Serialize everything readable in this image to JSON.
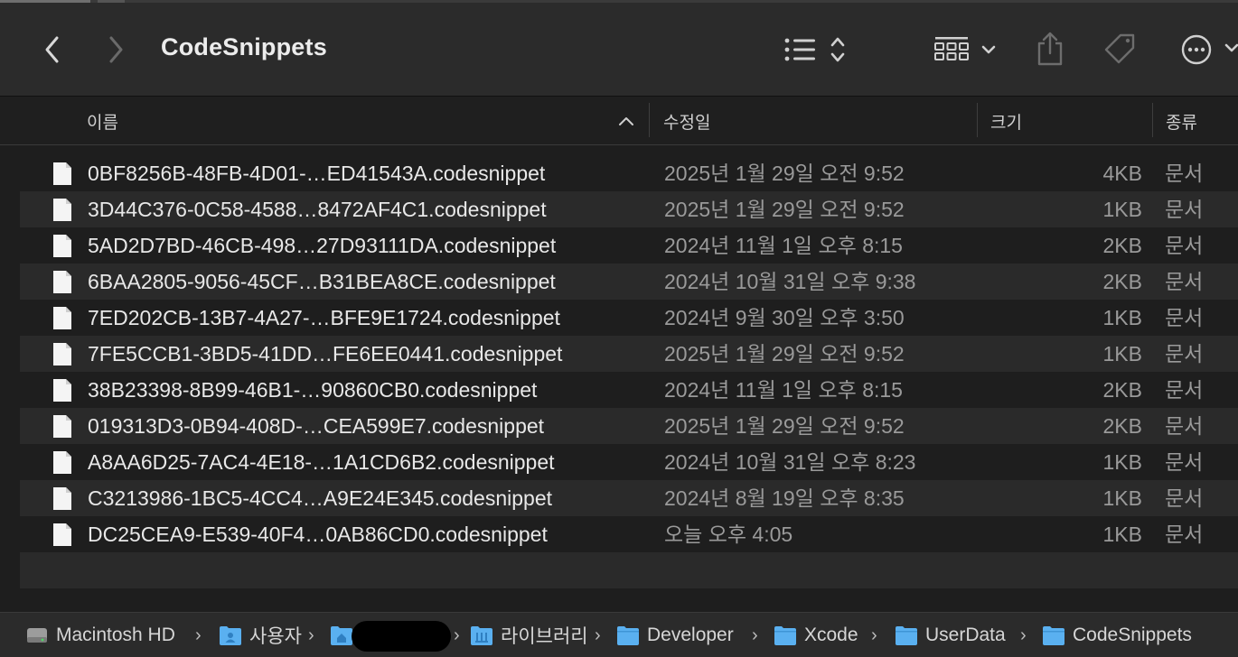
{
  "window": {
    "title": "CodeSnippets"
  },
  "toolbar": {
    "back_icon": "chevron-left-icon",
    "forward_icon": "chevron-right-icon",
    "sort_icon": "list-sort-icon",
    "view_icon": "grid-view-icon",
    "share_icon": "share-icon",
    "tag_icon": "tag-icon",
    "more_icon": "more-icon"
  },
  "columns": {
    "name": "이름",
    "date": "수정일",
    "size": "크기",
    "kind": "종류"
  },
  "files": [
    {
      "name": "0BF8256B-48FB-4D01-…ED41543A.codesnippet",
      "date": "2025년 1월 29일 오전 9:52",
      "size": "4KB",
      "kind": "문서"
    },
    {
      "name": "3D44C376-0C58-4588…8472AF4C1.codesnippet",
      "date": "2025년 1월 29일 오전 9:52",
      "size": "1KB",
      "kind": "문서"
    },
    {
      "name": "5AD2D7BD-46CB-498…27D93111DA.codesnippet",
      "date": "2024년 11월 1일 오후 8:15",
      "size": "2KB",
      "kind": "문서"
    },
    {
      "name": "6BAA2805-9056-45CF…B31BEA8CE.codesnippet",
      "date": "2024년 10월 31일 오후 9:38",
      "size": "2KB",
      "kind": "문서"
    },
    {
      "name": "7ED202CB-13B7-4A27-…BFE9E1724.codesnippet",
      "date": "2024년 9월 30일 오후 3:50",
      "size": "1KB",
      "kind": "문서"
    },
    {
      "name": "7FE5CCB1-3BD5-41DD…FE6EE0441.codesnippet",
      "date": "2025년 1월 29일 오전 9:52",
      "size": "1KB",
      "kind": "문서"
    },
    {
      "name": "38B23398-8B99-46B1-…90860CB0.codesnippet",
      "date": "2024년 11월 1일 오후 8:15",
      "size": "2KB",
      "kind": "문서"
    },
    {
      "name": "019313D3-0B94-408D-…CEA599E7.codesnippet",
      "date": "2025년 1월 29일 오전 9:52",
      "size": "2KB",
      "kind": "문서"
    },
    {
      "name": "A8AA6D25-7AC4-4E18-…1A1CD6B2.codesnippet",
      "date": "2024년 10월 31일 오후 8:23",
      "size": "1KB",
      "kind": "문서"
    },
    {
      "name": "C3213986-1BC5-4CC4…A9E24E345.codesnippet",
      "date": "2024년 8월 19일 오후 8:35",
      "size": "1KB",
      "kind": "문서"
    },
    {
      "name": "DC25CEA9-E539-40F4…0AB86CD0.codesnippet",
      "date": "오늘 오후 4:05",
      "size": "1KB",
      "kind": "문서"
    }
  ],
  "pathbar": {
    "items": [
      {
        "label": "Macintosh HD",
        "icon": "hard-drive-icon"
      },
      {
        "label": "사용자",
        "icon": "users-folder-icon"
      },
      {
        "label": "",
        "icon": "home-folder-icon"
      },
      {
        "label": "라이브러리",
        "icon": "library-folder-icon"
      },
      {
        "label": "Developer",
        "icon": "folder-icon"
      },
      {
        "label": "Xcode",
        "icon": "folder-icon"
      },
      {
        "label": "UserData",
        "icon": "folder-icon"
      },
      {
        "label": "CodeSnippets",
        "icon": "folder-icon"
      }
    ],
    "separator": "›"
  },
  "colors": {
    "folder": "#5ab0f0",
    "background": "#1e1e1e",
    "toolbar": "#2b2b2b"
  }
}
